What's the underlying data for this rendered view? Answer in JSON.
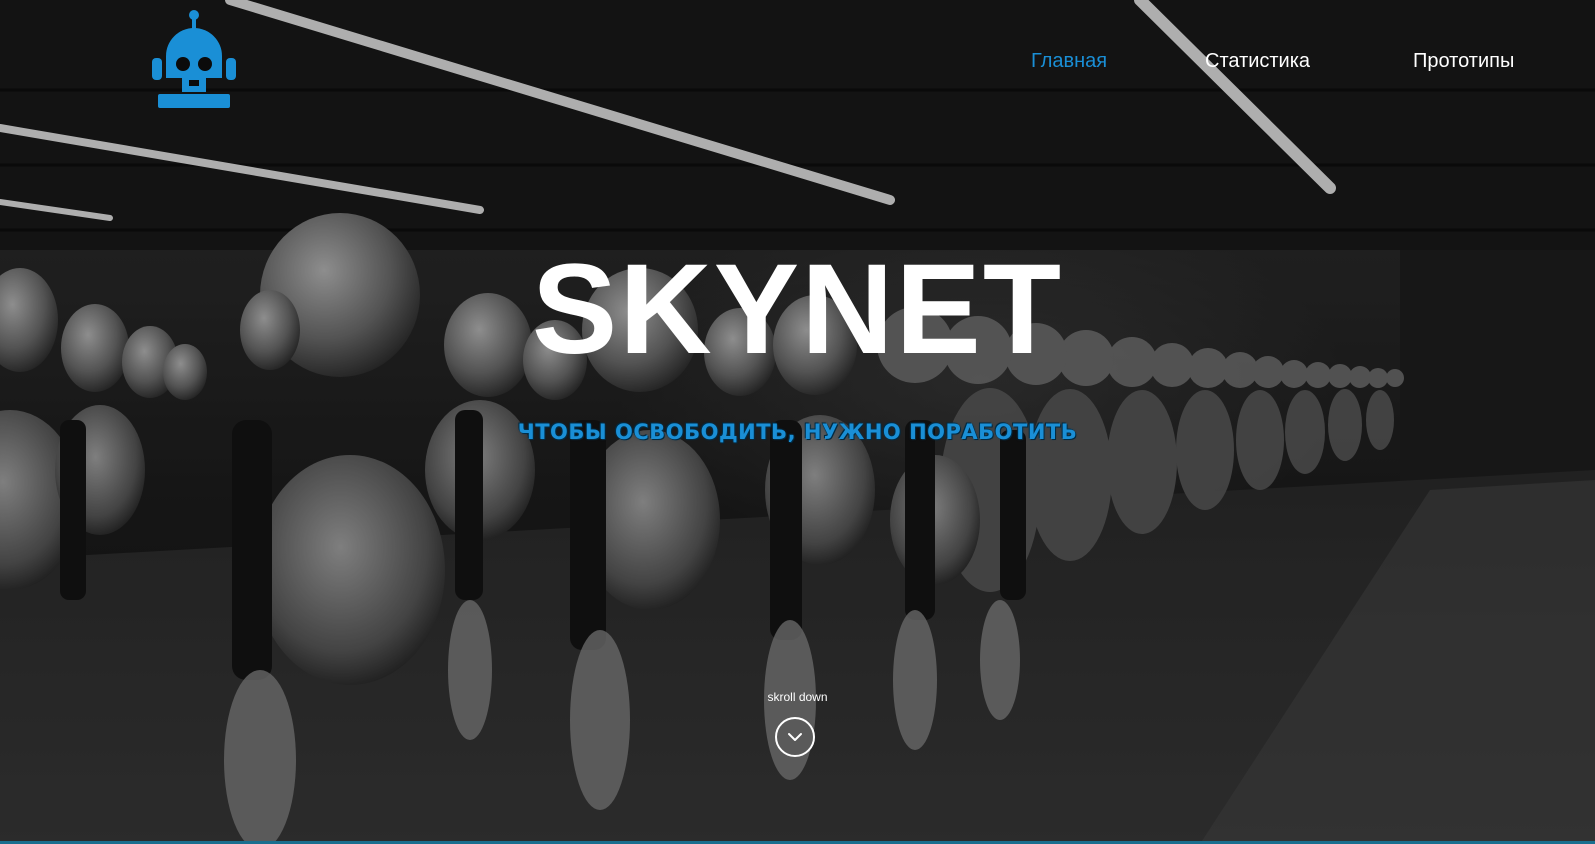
{
  "brand": {
    "logo_icon": "robot-head-icon",
    "accent_color": "#1a8fd6"
  },
  "nav": {
    "items": [
      {
        "label": "Главная",
        "active": true
      },
      {
        "label": "Статистика",
        "active": false
      },
      {
        "label": "Прототипы",
        "active": false
      }
    ]
  },
  "hero": {
    "title": "SKYNET",
    "tagline": "ЧТОБЫ ОСВОБОДИТЬ, НУЖНО ПОРАБОТИТЬ",
    "background_image": "rows-of-humanoid-robots-photo"
  },
  "scroll": {
    "label": "skroll down",
    "icon": "chevron-down-circle-icon"
  }
}
